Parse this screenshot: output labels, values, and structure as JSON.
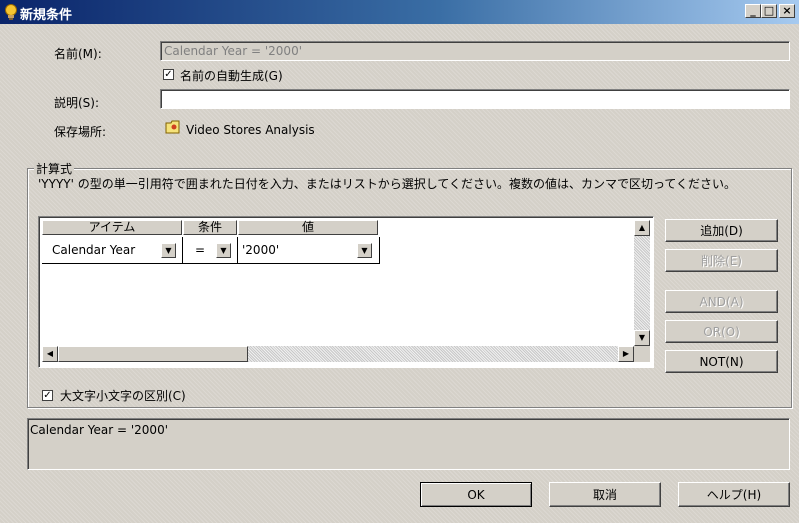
{
  "window": {
    "title": "新規条件",
    "minimize_glyph": "_",
    "maximize_glyph": "□",
    "close_glyph": "×",
    "icon": "lightbulb-icon"
  },
  "form": {
    "name_label": "名前(M):",
    "name_value": "Calendar Year = '2000'",
    "auto_name_label": "名前の自動生成(G)",
    "auto_name_checked": true,
    "description_label": "説明(S):",
    "description_value": "",
    "location_label": "保存場所:",
    "location_value": "Video Stores Analysis",
    "location_icon": "folder-icon"
  },
  "expression": {
    "group_label": "計算式",
    "instruction": "'YYYY' の型の単一引用符で囲まれた日付を入力、またはリストから選択してください。複数の値は、カンマで区切ってください。",
    "columns": [
      "アイテム",
      "条件",
      "値"
    ],
    "rows": [
      {
        "item": "Calendar Year",
        "condition": "=",
        "value": "'2000'"
      }
    ],
    "case_sensitive_label": "大文字小文字の区別(C)",
    "case_sensitive_checked": true
  },
  "side_buttons": {
    "add": "追加(D)",
    "delete": "削除(E)",
    "and": "AND(A)",
    "or": "OR(O)",
    "not": "NOT(N)"
  },
  "preview": {
    "text": "Calendar Year = '2000'"
  },
  "footer_buttons": {
    "ok": "OK",
    "cancel": "取消",
    "help": "ヘルプ(H)"
  },
  "colors": {
    "titlebar_start": "#0a246a",
    "titlebar_end": "#a6caf0",
    "face": "#d4d0c8"
  }
}
